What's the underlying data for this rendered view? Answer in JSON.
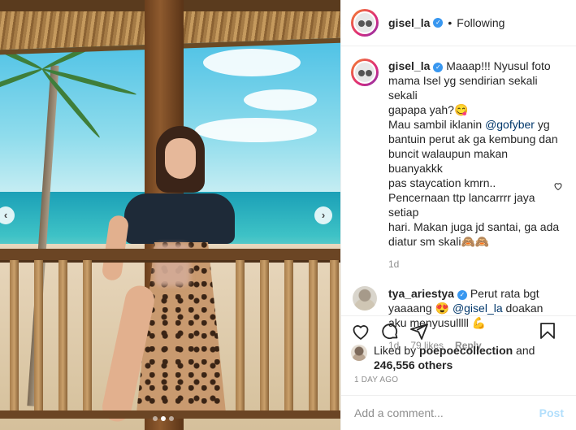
{
  "post": {
    "username": "gisel_la",
    "follow_status": "Following",
    "separator": "•",
    "time_ago": "1 DAY AGO"
  },
  "caption": {
    "username": "gisel_la",
    "text_lines": [
      "Maaap!!! Nyusul foto",
      "mama Isel yg sendirian sekali sekali",
      "gapapa yah?😋",
      "Mau sambil iklanin ",
      "bantuin perut ak ga kembung dan",
      "buncit walaupun makan buanyakkk",
      "pas staycation kmrn..",
      "Pencernaan ttp lancarrrr jaya setiap",
      "hari. Makan juga jd santai, ga ada",
      "diatur sm skali🙈🙈"
    ],
    "mention": "@gofyber",
    "mention_suffix": " yg",
    "age": "1d"
  },
  "comment": {
    "username": "tya_ariestya",
    "text_before": " Perut rata bgt yaaaang 😍 ",
    "mention": "@gisel_la",
    "text_after": " doakan aku menyusulllll 💪",
    "age": "1d",
    "likes": "79 likes",
    "reply": "Reply"
  },
  "likes": {
    "prefix": "Liked by ",
    "user": "poepoecollection",
    "middle": " and ",
    "count": "246,556 others"
  },
  "composer": {
    "placeholder": "Add a comment...",
    "post_label": "Post"
  },
  "carousel": {
    "prev": "‹",
    "next": "›",
    "slides": 3,
    "active_slide": 2
  },
  "icons": {
    "like": "heart-icon",
    "comment": "comment-icon",
    "share": "send-icon",
    "save": "bookmark-icon",
    "verified": "verified-badge-icon"
  },
  "colors": {
    "verified": "#3897f0",
    "link": "#00376b",
    "muted": "#8e8e8e",
    "post_disabled": "#b2dffc"
  }
}
